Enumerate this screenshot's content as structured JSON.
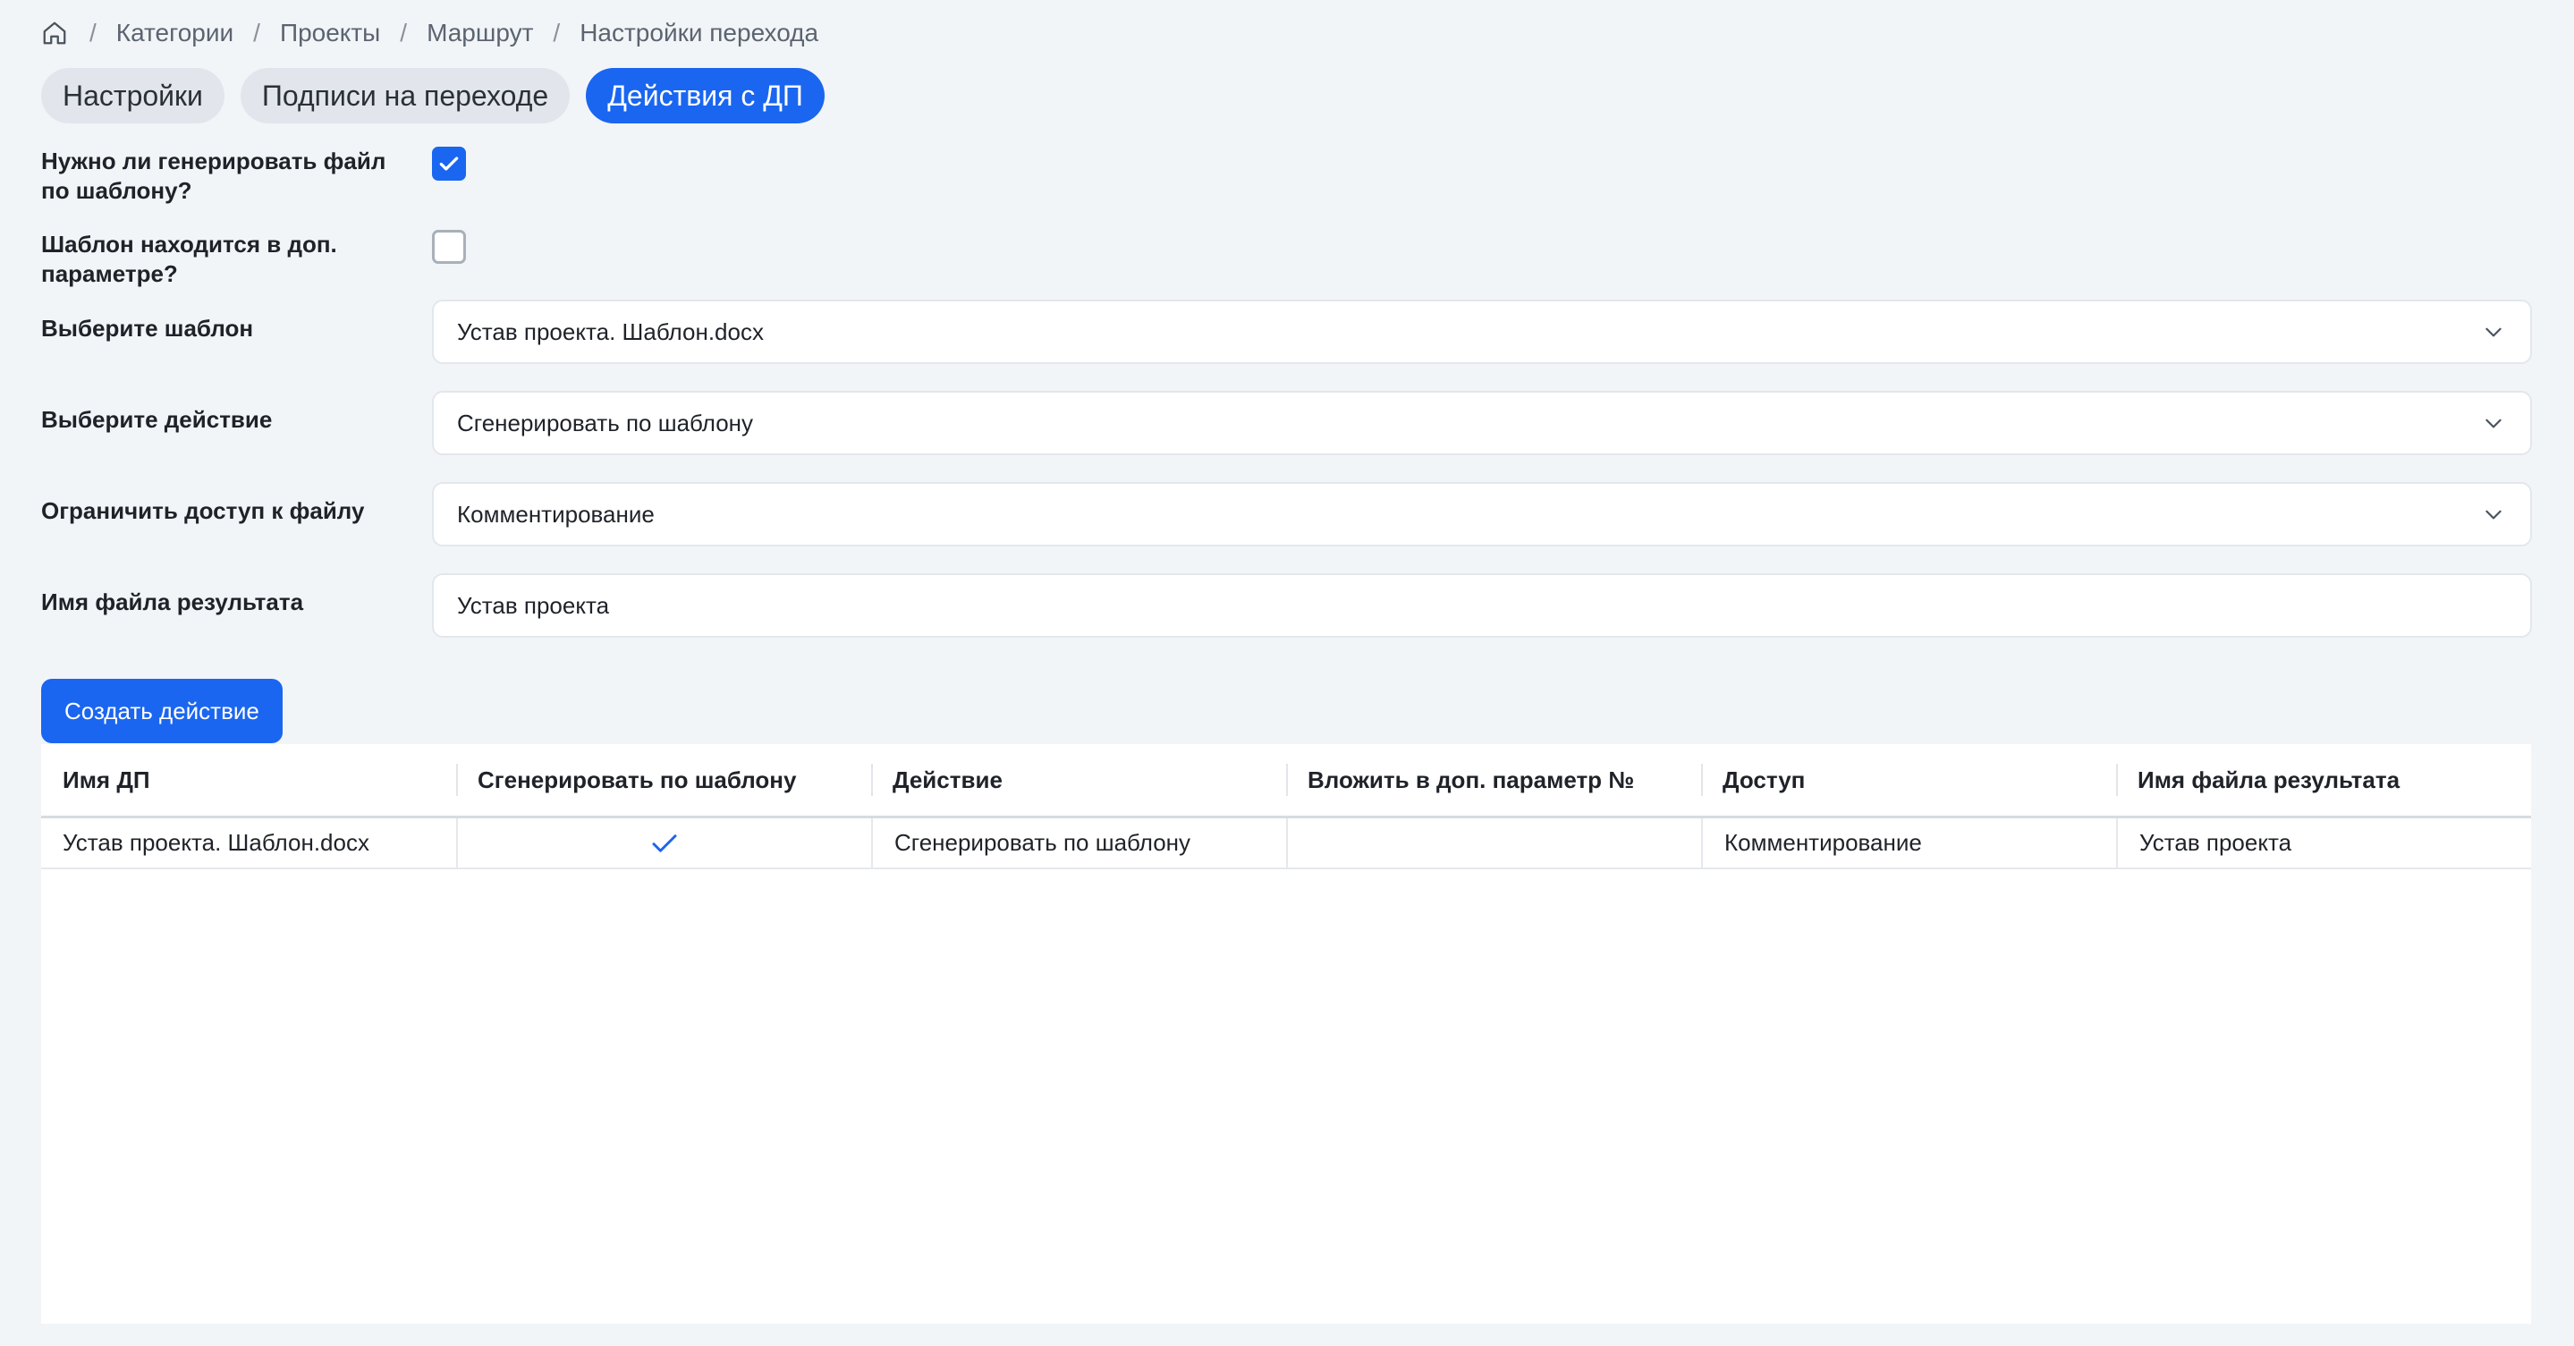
{
  "breadcrumb": {
    "items": [
      "Категории",
      "Проекты",
      "Маршрут",
      "Настройки перехода"
    ]
  },
  "tabs": [
    {
      "label": "Настройки",
      "active": false
    },
    {
      "label": "Подписи на переходе",
      "active": false
    },
    {
      "label": "Действия с ДП",
      "active": true
    }
  ],
  "form": {
    "generate_label": "Нужно ли генерировать файл по шаблону?",
    "generate_checked": true,
    "template_in_param_label": "Шаблон находится в доп. параметре?",
    "template_in_param_checked": false,
    "template_label": "Выберите шаблон",
    "template_value": "Устав проекта. Шаблон.docx",
    "action_label": "Выберите действие",
    "action_value": "Сгенерировать по шаблону",
    "access_label": "Ограничить доступ к файлу",
    "access_value": "Комментирование",
    "filename_label": "Имя файла результата",
    "filename_value": "Устав проекта"
  },
  "create_button_label": "Создать действие",
  "table": {
    "columns": [
      "Имя ДП",
      "Сгенерировать по шаблону",
      "Действие",
      "Вложить в доп. параметр №",
      "Доступ",
      "Имя файла результата"
    ],
    "rows": [
      {
        "name": "Устав проекта. Шаблон.docx",
        "generate": true,
        "action": "Сгенерировать по шаблону",
        "param_no": "",
        "access": "Комментирование",
        "result_filename": "Устав проекта"
      }
    ]
  },
  "colors": {
    "accent": "#1a66f0",
    "background": "#f2f5f8",
    "tab_inactive": "#e2e6ec"
  },
  "icons": {
    "home": "home-icon",
    "chevron": "chevron-down-icon",
    "check": "check-icon"
  }
}
